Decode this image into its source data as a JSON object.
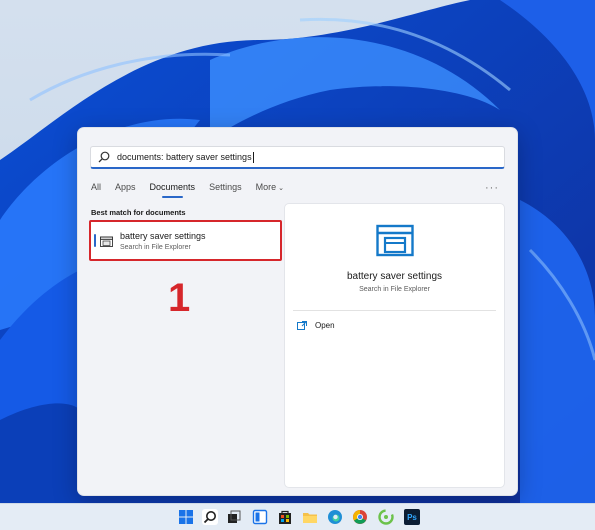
{
  "search": {
    "query": "documents: battery saver settings"
  },
  "tabs": [
    {
      "label": "All"
    },
    {
      "label": "Apps"
    },
    {
      "label": "Documents",
      "active": true
    },
    {
      "label": "Settings"
    },
    {
      "label": "More"
    }
  ],
  "more_options_label": "···",
  "best_match": {
    "section_label": "Best match for documents",
    "title": "battery saver settings",
    "subtitle": "Search in File Explorer"
  },
  "annotation": "1",
  "detail": {
    "title": "battery saver settings",
    "subtitle": "Search in File Explorer",
    "actions": [
      {
        "label": "Open",
        "icon": "open-icon"
      }
    ]
  },
  "taskbar": {
    "icons": [
      "start-icon",
      "search-icon",
      "task-view-icon",
      "widgets-icon",
      "store-icon",
      "file-explorer-icon",
      "edge-icon",
      "chrome-icon",
      "app-icon",
      "photoshop-icon"
    ],
    "photoshop_label": "Ps"
  },
  "colors": {
    "accent": "#2a67c8",
    "highlight_box": "#d6262b",
    "panel_bg": "#f2f3f7"
  }
}
